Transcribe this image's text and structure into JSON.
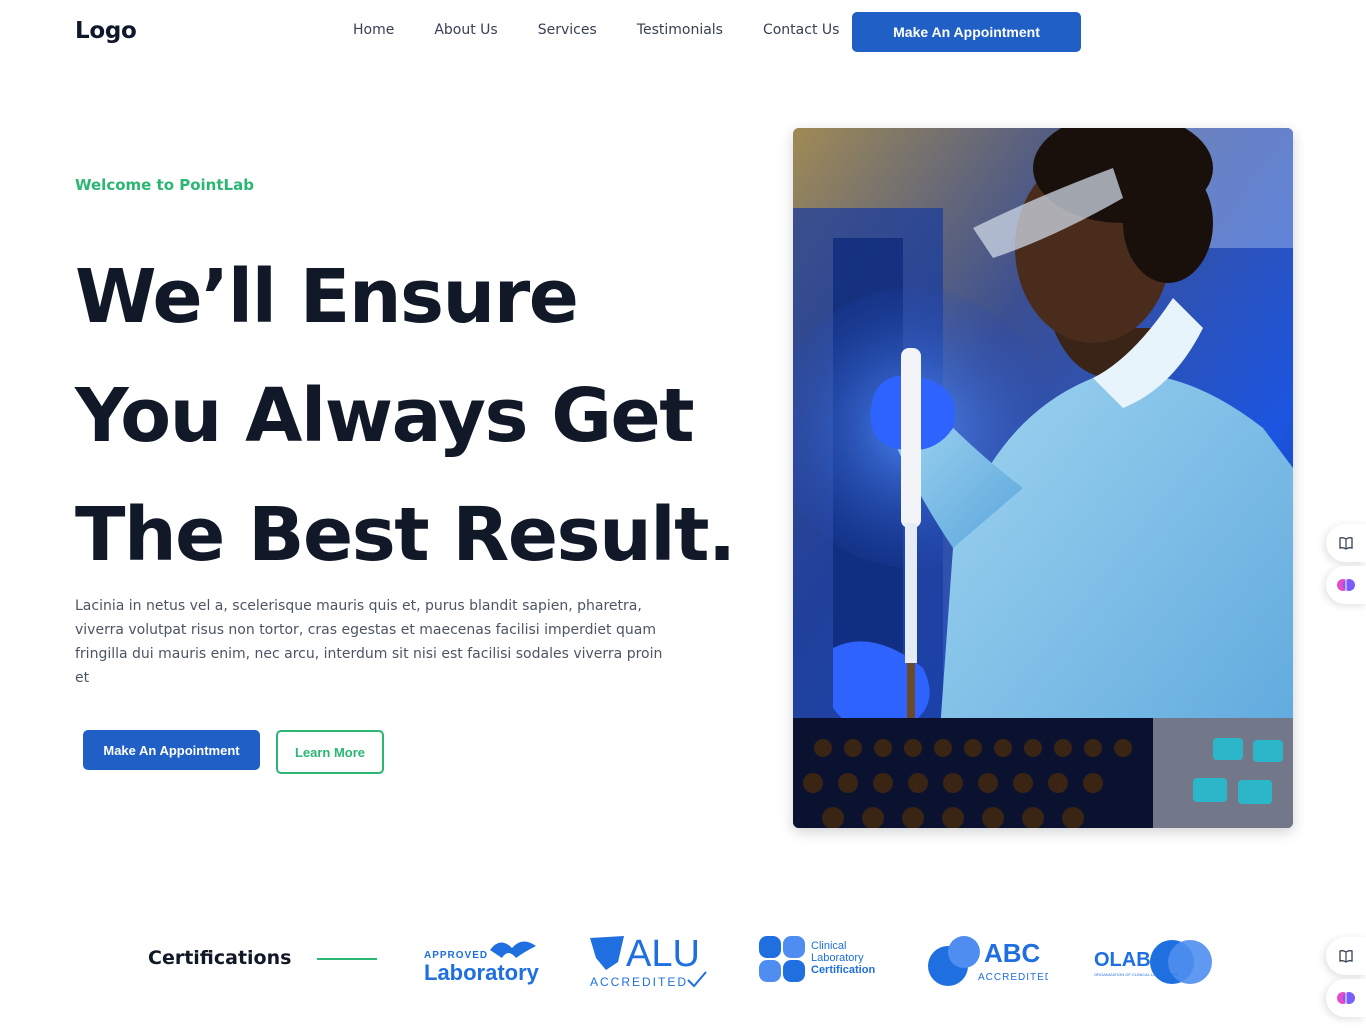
{
  "nav": {
    "logo": "Logo",
    "links": [
      "Home",
      "About Us",
      "Services",
      "Testimonials",
      "Contact Us"
    ],
    "cta": "Make An Appointment"
  },
  "hero": {
    "eyebrow": "Welcome to PointLab",
    "headline": [
      "We’ll Ensure",
      "You Always Get",
      "The Best Result."
    ],
    "lead": "Lacinia in netus vel a, scelerisque mauris quis et, purus blandit sapien, pharetra, viverra volutpat risus non tortor, cras egestas et maecenas facilisi imperdiet quam fringilla dui mauris enim, nec arcu, interdum sit nisi est facilisi sodales viverra proin et",
    "primary_button": "Make An Appointment",
    "secondary_button": "Learn More"
  },
  "certifications": {
    "title": "Certifications",
    "logos": [
      {
        "name": "approved-laboratory",
        "line1": "APPROVED",
        "line2": "Laboratory"
      },
      {
        "name": "alu-accredited",
        "line1": "ALU",
        "line2": "ACCREDITED"
      },
      {
        "name": "clinical-laboratory-certification",
        "line1": "Clinical",
        "line2": "Laboratory",
        "line3": "Certification"
      },
      {
        "name": "abc-accredited",
        "line1": "ABC",
        "line2": "ACCREDITED"
      },
      {
        "name": "olab",
        "line1": "OLAB",
        "line2": "ORGANIZATION OF CLINICAL LABORATORY"
      }
    ]
  },
  "colors": {
    "primary": "#1f5fc6",
    "accent": "#2bb673",
    "heading": "#111827",
    "body": "#4b5563",
    "logo_blue": "#1f6fe0"
  },
  "side_widgets": [
    "book-icon",
    "brain-icon",
    "book-icon",
    "brain-icon"
  ]
}
